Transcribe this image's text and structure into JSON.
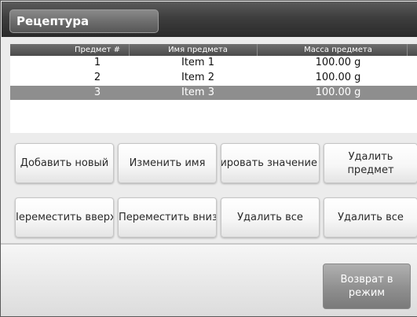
{
  "header": {
    "title": "Рецептура"
  },
  "table": {
    "columns": [
      "Предмет #",
      "Имя предмета",
      "Масса предмета"
    ],
    "rows": [
      {
        "num": "1",
        "name": "Item 1",
        "mass": "100.00 g"
      },
      {
        "num": "2",
        "name": "Item 2",
        "mass": "100.00 g"
      },
      {
        "num": "3",
        "name": "Item 3",
        "mass": "100.00 g"
      }
    ],
    "selected_row": "3"
  },
  "buttons": {
    "add_new": "Добавить новый",
    "rename": "Изменить имя",
    "edit_value": "ировать значение",
    "delete_item": "Удалить предмет",
    "move_up": "Iереместить вверх",
    "move_down": "Переместить вниз",
    "delete_all_1": "Удалить все",
    "delete_all_2": "Удалить все",
    "return": "Возврат в режим"
  },
  "colors": {
    "header_bg": "#3e3e3e",
    "selected_row_bg": "#8e8e8e",
    "return_button_bg": "#8f8f8f"
  }
}
